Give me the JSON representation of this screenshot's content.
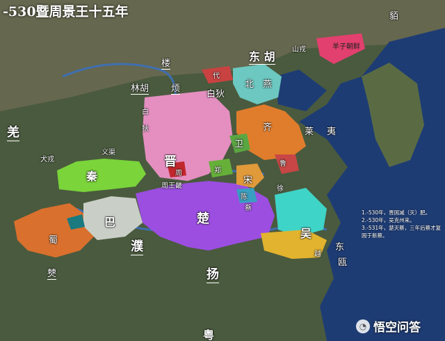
{
  "title": "-530暨周景王十五年",
  "labels": {
    "mo": "貊",
    "shanrong": "山戎",
    "yuzi": "羊子朝鲜",
    "donghu": "东 胡",
    "lou": "楼",
    "linhu": "林胡",
    "fan": "烦",
    "baidi": "白狄",
    "dai": "代",
    "bei": "北",
    "yan": "燕",
    "qiang": "羌",
    "jin": "晋",
    "qin": "秦",
    "wei": "卫",
    "qi": "齐",
    "song": "宋",
    "lai": "莱",
    "yi": "夷",
    "lu": "鲁",
    "ba": "巴",
    "shu": "蜀",
    "pu": "濮",
    "chu": "楚",
    "wu": "吴",
    "yue": "越",
    "dong": "东",
    "ou": "瓯",
    "yang": "扬",
    "yue2": "粤",
    "bo": "僰",
    "zhou": "周",
    "zheng": "郑",
    "chen": "陈",
    "cai": "蔡",
    "xu": "徐",
    "bai": "白",
    "di": "狄",
    "ji": "冀",
    "yiqu": "义渠",
    "quanrong": "犬戎",
    "zhouwang": "周王畿",
    "yiguo": "余",
    "fangfu": "方国"
  },
  "notes": [
    "1.-530年，晋国减（灭）肥。",
    "2.-530年，吴克州来。",
    "3.-531年，楚灭蔡，三年后蔡才复国于新蔡。"
  ],
  "watermark": "悟空问答",
  "colors": {
    "sea": "#1e3c74",
    "land": "#4a5a3e",
    "jin": "#e48fc0",
    "qin": "#7ad43a",
    "chu": "#9b4ee0",
    "qi": "#e07d2c",
    "yan": "#6cc8c0",
    "wu": "#3fd4c8",
    "yue": "#e2b32e",
    "shu": "#d9702d",
    "ba": "#c9cfc7",
    "song": "#e09a3a",
    "lu": "#c84646",
    "wei": "#5aa642",
    "zhou": "#c1272d",
    "chaoxian": "#e2406e",
    "dai": "#c94242",
    "zheng": "#66b03a",
    "cai": "#3a9ec0"
  }
}
